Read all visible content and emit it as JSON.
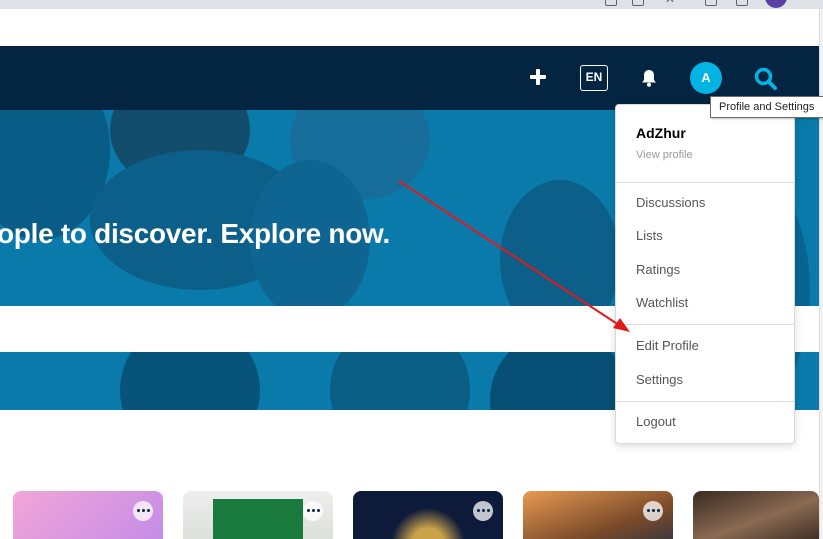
{
  "nav": {
    "lang_label": "EN",
    "avatar_initial": "A",
    "add_icon": "plus-icon",
    "bell_icon": "bell-icon",
    "search_icon": "search-icon"
  },
  "tooltip": {
    "text": "Profile and Settings"
  },
  "hero": {
    "headline": "ople to discover. Explore now."
  },
  "profile_menu": {
    "username": "AdZhur",
    "view_profile": "View profile",
    "items_group1": [
      "Discussions",
      "Lists",
      "Ratings",
      "Watchlist"
    ],
    "items_group2": [
      "Edit Profile",
      "Settings"
    ],
    "logout": "Logout"
  },
  "colors": {
    "navbar": "#032541",
    "accent": "#01b4e4",
    "arrow": "#e01b1b"
  }
}
